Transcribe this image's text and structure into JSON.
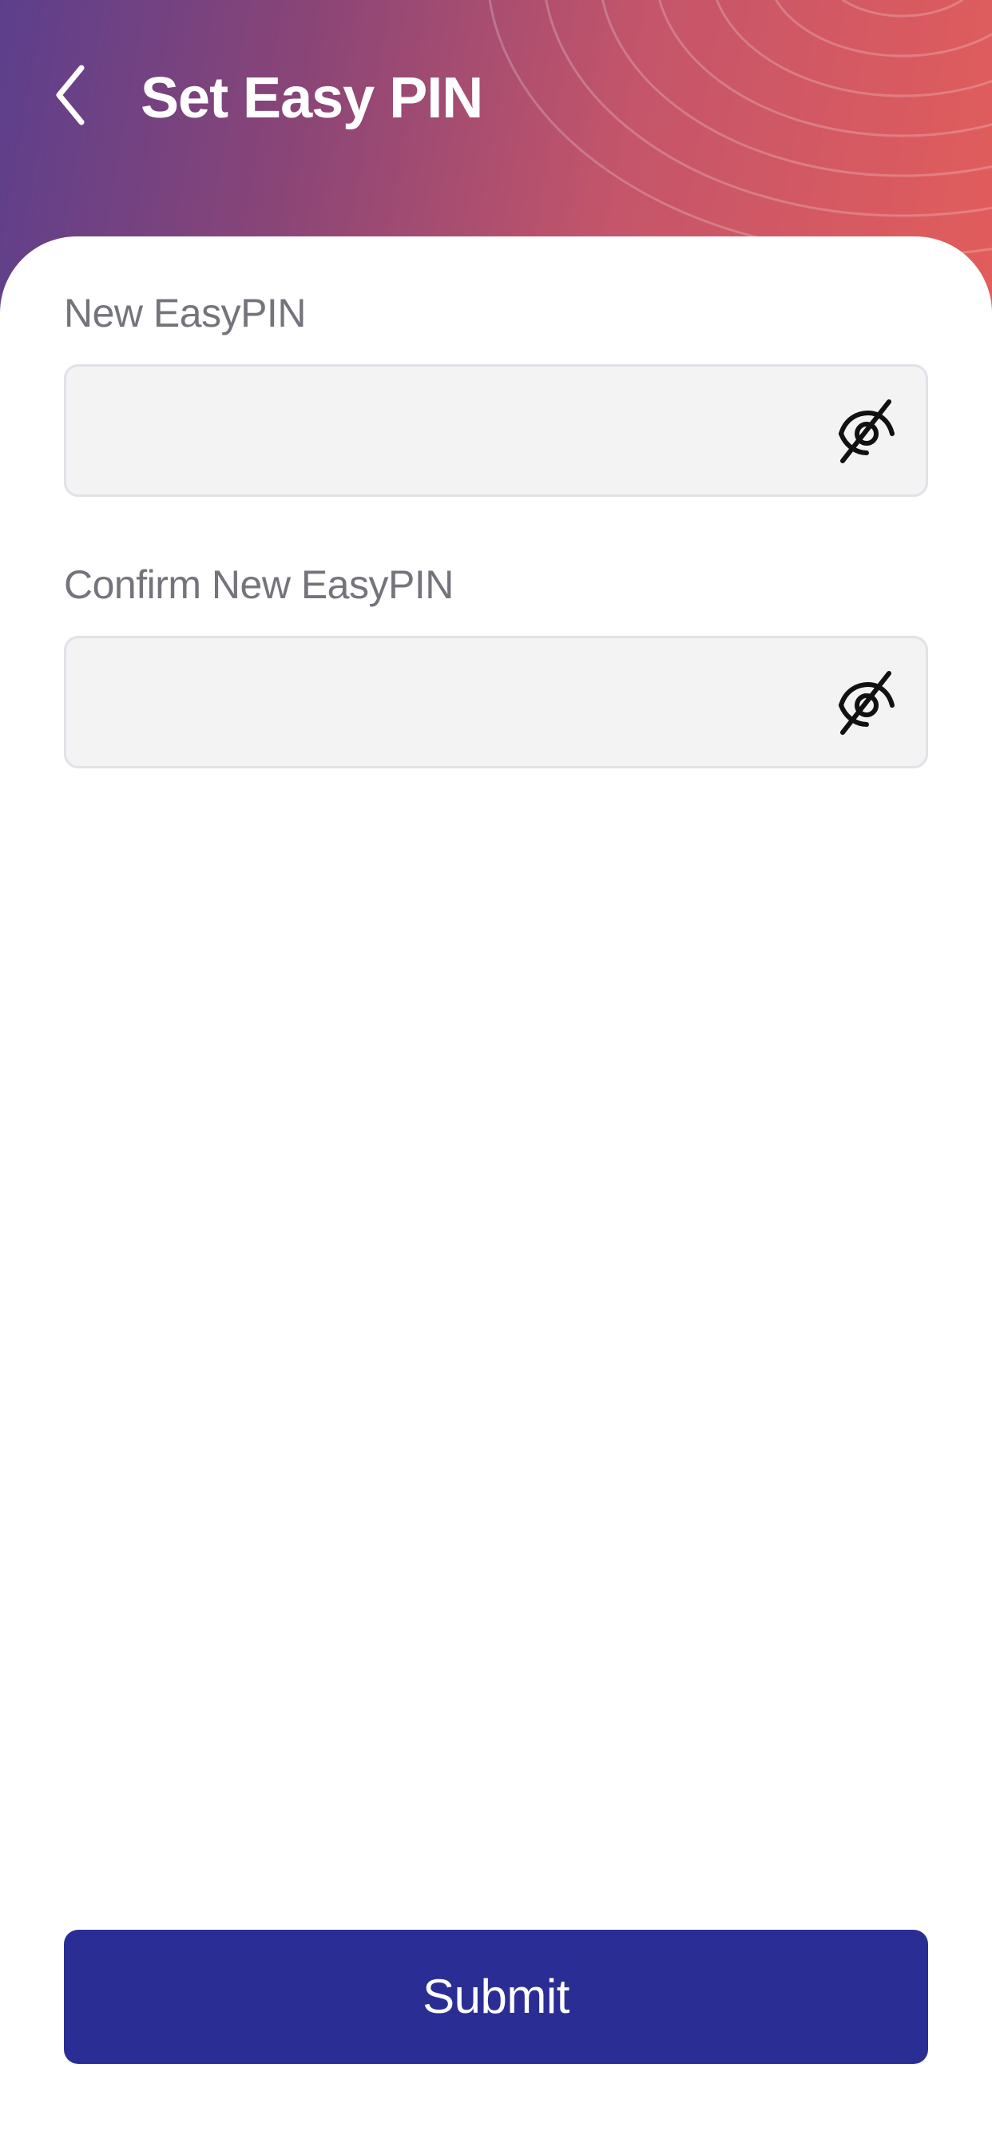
{
  "header": {
    "title": "Set Easy PIN",
    "back_icon": "chevron-left-icon"
  },
  "form": {
    "new_pin": {
      "label": "New EasyPIN",
      "value": "",
      "visibility_icon": "eye-off-icon"
    },
    "confirm_pin": {
      "label": "Confirm New EasyPIN",
      "value": "",
      "visibility_icon": "eye-off-icon"
    }
  },
  "actions": {
    "submit_label": "Submit"
  },
  "colors": {
    "header_gradient_start": "#5c3f8c",
    "header_gradient_end": "#e25d5b",
    "submit_button": "#2a2e94",
    "field_background": "#f3f3f4",
    "field_border": "#e1e1e8",
    "label_text": "#74747c"
  }
}
